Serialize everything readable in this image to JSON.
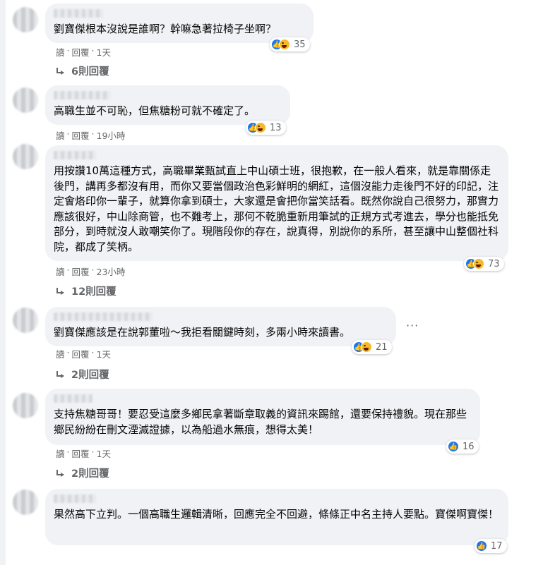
{
  "comments": [
    {
      "text": "劉寶傑根本沒說是誰啊？幹嘛急著拉椅子坐啊？",
      "reaction_count": "35",
      "actions": {
        "read": "讀",
        "reply": "回覆",
        "time": "1天"
      },
      "replies_label": "6則回覆"
    },
    {
      "text": "高職生並不可恥，但焦糖粉可就不確定了。",
      "reaction_count": "13",
      "actions": {
        "read": "讀",
        "reply": "回覆",
        "time": "19小時"
      },
      "replies_label": ""
    },
    {
      "text": "用按讚10萬這種方式，高職畢業甄試直上中山碩士班，很抱歉，在一般人看來，就是靠關係走後門，講再多都沒有用，而你又要當個政治色彩鮮明的網紅，這個沒能力走後門不好的印記，注定會烙印你一輩子，就算你拿到碩士，大家還是會把你當笑話看。既然你說自己很努力，那實力應該很好，中山除商管，也不難考上，那何不乾脆重新用筆試的正規方式考進去，學分也能抵免部分，到時就沒人敢嘲笑你了。現階段你的存在，說真得，別說你的系所，甚至讓中山整個社科院，都成了笑柄。",
      "reaction_count": "73",
      "actions": {
        "read": "讀",
        "reply": "回覆",
        "time": "23小時"
      },
      "replies_label": "12則回覆"
    },
    {
      "text": "劉寶傑應該是在說郭董啦～我拒看關鍵時刻，多兩小時來讀書。",
      "reaction_count": "21",
      "actions": {
        "read": "讀",
        "reply": "回覆",
        "time": "1天"
      },
      "replies_label": "2則回覆",
      "more": "···"
    },
    {
      "text": "支持焦糖哥哥！要忍受這麼多鄉民拿著斷章取義的資訊來踢館，還要保持禮貌。現在那些鄉民紛紛在刪文湮滅證據，以為船過水無痕，想得太美！",
      "reaction_count": "16",
      "actions": {
        "read": "讀",
        "reply": "回覆",
        "time": "1天"
      },
      "replies_label": "2則回覆"
    },
    {
      "text": "果然高下立判。一個高職生邏輯清晰，回應完全不回避，條條正中名主持人要點。寶傑啊寶傑！",
      "reaction_count": "17",
      "actions": {
        "read": "",
        "reply": "",
        "time": ""
      },
      "replies_label": ""
    }
  ]
}
